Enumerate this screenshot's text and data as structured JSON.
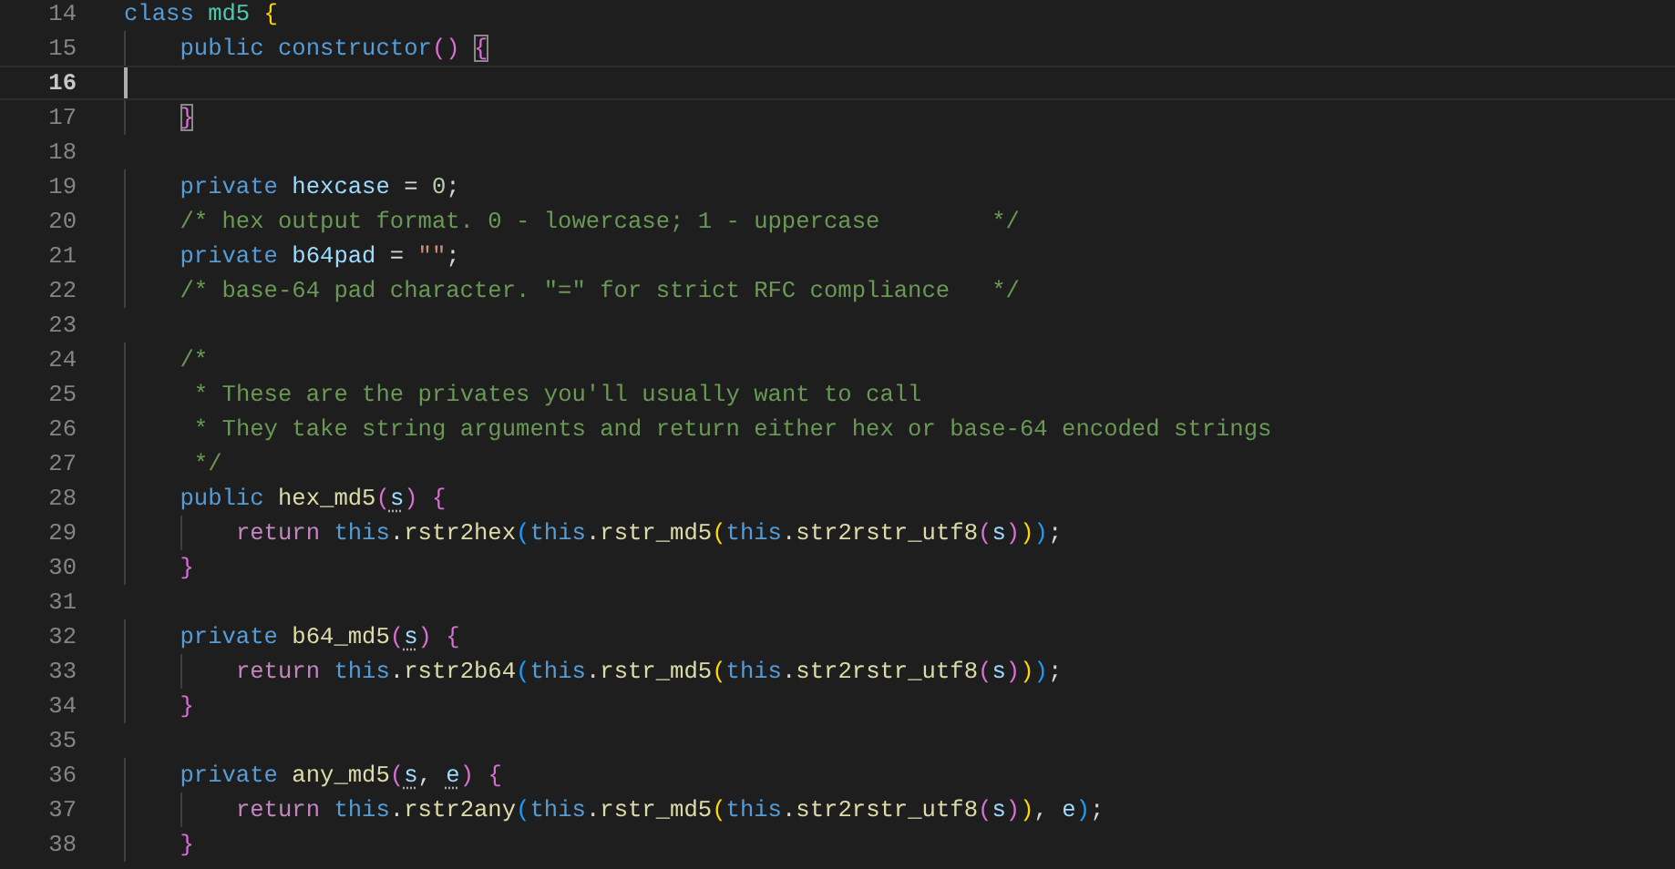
{
  "editor": {
    "lines": [
      {
        "number": "14",
        "current": false,
        "tokens": [
          {
            "text": "class ",
            "kind": "kw"
          },
          {
            "text": "md5 ",
            "kind": "type"
          },
          {
            "text": "{",
            "kind": "b1"
          }
        ]
      },
      {
        "number": "15",
        "current": false,
        "tokens": [
          {
            "text": "    public ",
            "kind": "kw"
          },
          {
            "text": "constructor",
            "kind": "kw"
          },
          {
            "text": "() ",
            "kind": "b2"
          },
          {
            "text": "{",
            "kind": "b2m"
          }
        ]
      },
      {
        "number": "16",
        "current": true
      },
      {
        "number": "17",
        "current": false,
        "tokens": [
          {
            "text": "    }",
            "kind": "b2m"
          }
        ]
      },
      {
        "number": "18",
        "current": false
      },
      {
        "number": "19",
        "current": false,
        "tokens": [
          {
            "text": "    private ",
            "kind": "kw"
          },
          {
            "text": "hexcase",
            "kind": "var"
          },
          {
            "text": " = ",
            "kind": "punc"
          },
          {
            "text": "0",
            "kind": "num"
          },
          {
            "text": ";",
            "kind": "punc"
          }
        ]
      },
      {
        "number": "20",
        "current": false,
        "tokens": [
          {
            "text": "    /* hex output format. 0 - lowercase; 1 - uppercase        */",
            "kind": "comment"
          }
        ]
      },
      {
        "number": "21",
        "current": false,
        "tokens": [
          {
            "text": "    private ",
            "kind": "kw"
          },
          {
            "text": "b64pad",
            "kind": "var"
          },
          {
            "text": " = ",
            "kind": "punc"
          },
          {
            "text": "\"\"",
            "kind": "str"
          },
          {
            "text": ";",
            "kind": "punc"
          }
        ]
      },
      {
        "number": "22",
        "current": false,
        "tokens": [
          {
            "text": "    /* base-64 pad character. \"=\" for strict RFC compliance   */",
            "kind": "comment"
          }
        ]
      },
      {
        "number": "23",
        "current": false
      },
      {
        "number": "24",
        "current": false,
        "tokens": [
          {
            "text": "    /*",
            "kind": "comment"
          }
        ]
      },
      {
        "number": "25",
        "current": false,
        "tokens": [
          {
            "text": "     * These are the privates you'll usually want to call",
            "kind": "comment"
          }
        ]
      },
      {
        "number": "26",
        "current": false,
        "tokens": [
          {
            "text": "     * They take string arguments and return either hex or base-64 encoded strings",
            "kind": "comment"
          }
        ]
      },
      {
        "number": "27",
        "current": false,
        "tokens": [
          {
            "text": "     */",
            "kind": "comment"
          }
        ]
      },
      {
        "number": "28",
        "current": false,
        "tokens": [
          {
            "text": "    public ",
            "kind": "kw"
          },
          {
            "text": "hex_md5",
            "kind": "fn"
          },
          {
            "text": "(",
            "kind": "b2"
          },
          {
            "text": "s",
            "kind": "unused"
          },
          {
            "text": ") ",
            "kind": "b2"
          },
          {
            "text": "{",
            "kind": "b2"
          }
        ]
      },
      {
        "number": "29",
        "current": false,
        "tokens": [
          {
            "text": "        return ",
            "kind": "ctrl"
          },
          {
            "text": "this",
            "kind": "kw"
          },
          {
            "text": ".",
            "kind": "punc"
          },
          {
            "text": "rstr2hex",
            "kind": "fn"
          },
          {
            "text": "(",
            "kind": "b3"
          },
          {
            "text": "this",
            "kind": "kw"
          },
          {
            "text": ".",
            "kind": "punc"
          },
          {
            "text": "rstr_md5",
            "kind": "fn"
          },
          {
            "text": "(",
            "kind": "b1"
          },
          {
            "text": "this",
            "kind": "kw"
          },
          {
            "text": ".",
            "kind": "punc"
          },
          {
            "text": "str2rstr_utf8",
            "kind": "fn"
          },
          {
            "text": "(",
            "kind": "b2"
          },
          {
            "text": "s",
            "kind": "var"
          },
          {
            "text": ")",
            "kind": "b2"
          },
          {
            "text": ")",
            "kind": "b1"
          },
          {
            "text": ")",
            "kind": "b3"
          },
          {
            "text": ";",
            "kind": "punc"
          }
        ]
      },
      {
        "number": "30",
        "current": false,
        "tokens": [
          {
            "text": "    }",
            "kind": "b2"
          }
        ]
      },
      {
        "number": "31",
        "current": false
      },
      {
        "number": "32",
        "current": false,
        "tokens": [
          {
            "text": "    private ",
            "kind": "kw"
          },
          {
            "text": "b64_md5",
            "kind": "fn"
          },
          {
            "text": "(",
            "kind": "b2"
          },
          {
            "text": "s",
            "kind": "unused"
          },
          {
            "text": ") ",
            "kind": "b2"
          },
          {
            "text": "{",
            "kind": "b2"
          }
        ]
      },
      {
        "number": "33",
        "current": false,
        "tokens": [
          {
            "text": "        return ",
            "kind": "ctrl"
          },
          {
            "text": "this",
            "kind": "kw"
          },
          {
            "text": ".",
            "kind": "punc"
          },
          {
            "text": "rstr2b64",
            "kind": "fn"
          },
          {
            "text": "(",
            "kind": "b3"
          },
          {
            "text": "this",
            "kind": "kw"
          },
          {
            "text": ".",
            "kind": "punc"
          },
          {
            "text": "rstr_md5",
            "kind": "fn"
          },
          {
            "text": "(",
            "kind": "b1"
          },
          {
            "text": "this",
            "kind": "kw"
          },
          {
            "text": ".",
            "kind": "punc"
          },
          {
            "text": "str2rstr_utf8",
            "kind": "fn"
          },
          {
            "text": "(",
            "kind": "b2"
          },
          {
            "text": "s",
            "kind": "var"
          },
          {
            "text": ")",
            "kind": "b2"
          },
          {
            "text": ")",
            "kind": "b1"
          },
          {
            "text": ")",
            "kind": "b3"
          },
          {
            "text": ";",
            "kind": "punc"
          }
        ]
      },
      {
        "number": "34",
        "current": false,
        "tokens": [
          {
            "text": "    }",
            "kind": "b2"
          }
        ]
      },
      {
        "number": "35",
        "current": false
      },
      {
        "number": "36",
        "current": false,
        "tokens": [
          {
            "text": "    private ",
            "kind": "kw"
          },
          {
            "text": "any_md5",
            "kind": "fn"
          },
          {
            "text": "(",
            "kind": "b2"
          },
          {
            "text": "s",
            "kind": "unused"
          },
          {
            "text": ", ",
            "kind": "punc"
          },
          {
            "text": "e",
            "kind": "unused"
          },
          {
            "text": ") ",
            "kind": "b2"
          },
          {
            "text": "{",
            "kind": "b2"
          }
        ]
      },
      {
        "number": "37",
        "current": false,
        "tokens": [
          {
            "text": "        return ",
            "kind": "ctrl"
          },
          {
            "text": "this",
            "kind": "kw"
          },
          {
            "text": ".",
            "kind": "punc"
          },
          {
            "text": "rstr2any",
            "kind": "fn"
          },
          {
            "text": "(",
            "kind": "b3"
          },
          {
            "text": "this",
            "kind": "kw"
          },
          {
            "text": ".",
            "kind": "punc"
          },
          {
            "text": "rstr_md5",
            "kind": "fn"
          },
          {
            "text": "(",
            "kind": "b1"
          },
          {
            "text": "this",
            "kind": "kw"
          },
          {
            "text": ".",
            "kind": "punc"
          },
          {
            "text": "str2rstr_utf8",
            "kind": "fn"
          },
          {
            "text": "(",
            "kind": "b2"
          },
          {
            "text": "s",
            "kind": "var"
          },
          {
            "text": ")",
            "kind": "b2"
          },
          {
            "text": ")",
            "kind": "b1"
          },
          {
            "text": ", ",
            "kind": "punc"
          },
          {
            "text": "e",
            "kind": "var"
          },
          {
            "text": ")",
            "kind": "b3"
          },
          {
            "text": ";",
            "kind": "punc"
          }
        ]
      },
      {
        "number": "38",
        "current": false,
        "tokens": [
          {
            "text": "    }",
            "kind": "b2"
          }
        ]
      }
    ]
  }
}
